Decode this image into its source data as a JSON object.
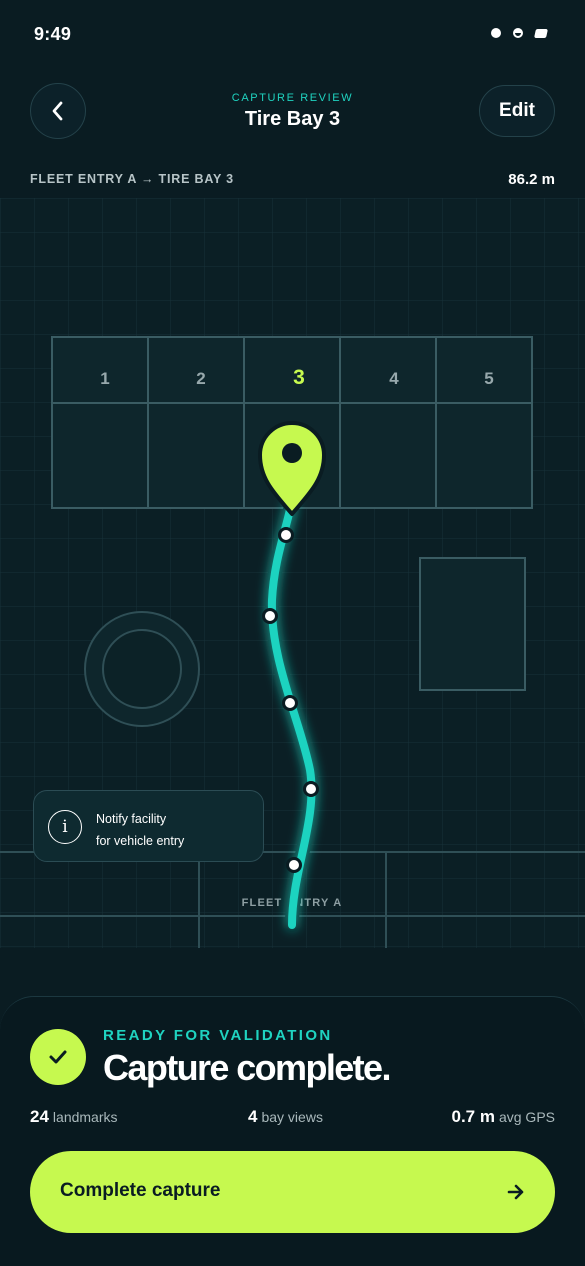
{
  "status_bar": {
    "time": "9:49"
  },
  "header": {
    "eyebrow": "CAPTURE REVIEW",
    "title": "Tire Bay 3",
    "edit_label": "Edit"
  },
  "route": {
    "label": "FLEET ENTRY A → TIRE BAY 3",
    "distance": "86.2 m"
  },
  "map": {
    "bays": [
      {
        "label": "1",
        "active": false
      },
      {
        "label": "2",
        "active": false
      },
      {
        "label": "3",
        "active": true
      },
      {
        "label": "4",
        "active": false
      },
      {
        "label": "5",
        "active": false
      }
    ],
    "entry_label": "FLEET ENTRY A",
    "path_color": "#1fd3c0",
    "pin_color": "#c6f94f"
  },
  "callout": {
    "line1": "Notify facility",
    "line2": "for vehicle entry"
  },
  "summary": {
    "eyebrow": "READY FOR VALIDATION",
    "title": "Capture complete.",
    "stats": [
      {
        "value": "24",
        "unit": "landmarks"
      },
      {
        "value": "4",
        "unit": "bay views"
      },
      {
        "value": "0.7 m",
        "unit": "avg GPS"
      }
    ],
    "cta_label": "Complete capture"
  },
  "colors": {
    "accent_lime": "#c6f94f",
    "accent_teal": "#1fd3c0",
    "background": "#0a1c22"
  }
}
